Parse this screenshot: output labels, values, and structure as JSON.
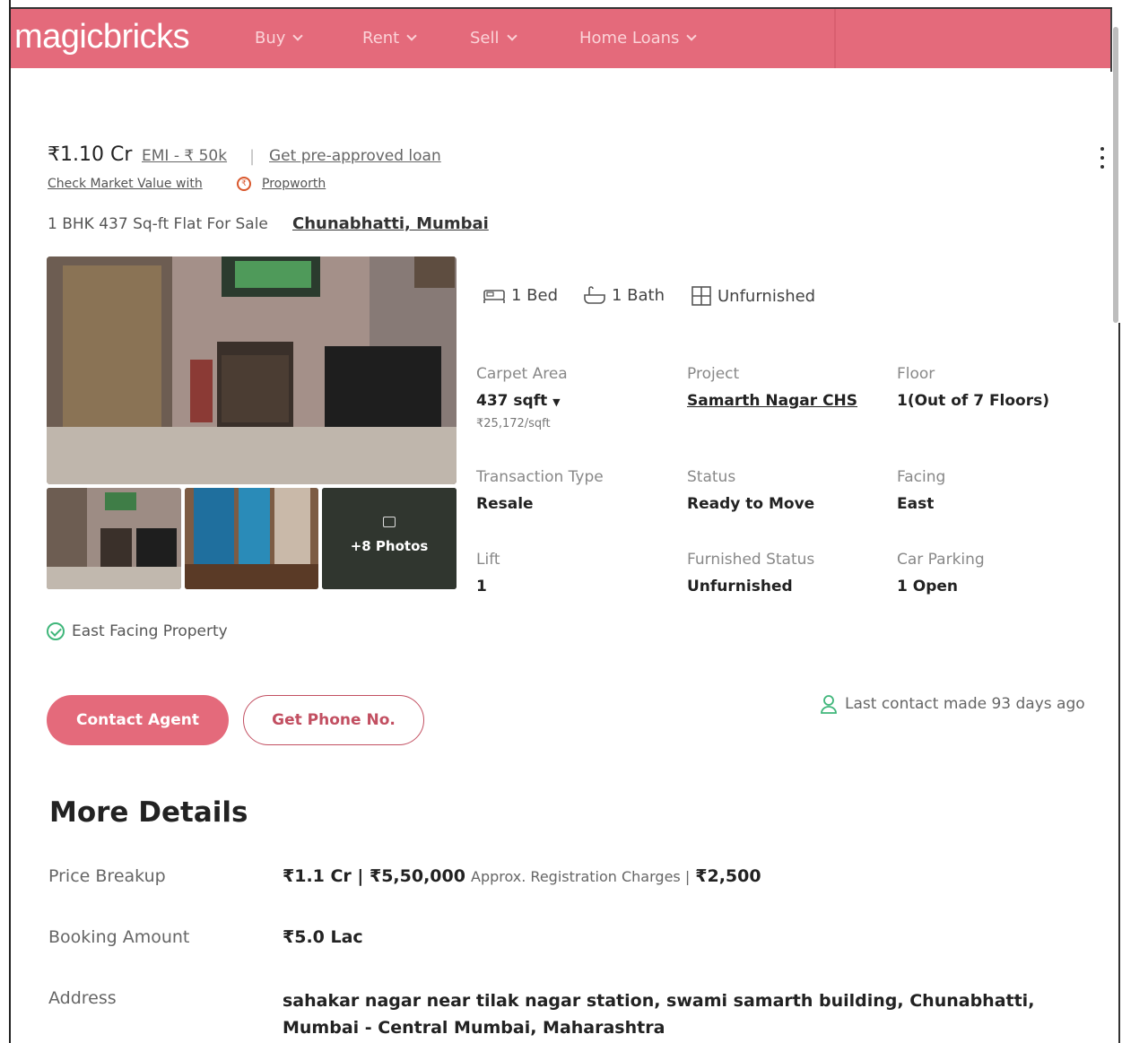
{
  "header": {
    "logo": "magicbricks",
    "nav": [
      {
        "label": "Buy"
      },
      {
        "label": "Rent"
      },
      {
        "label": "Sell"
      },
      {
        "label": "Home Loans"
      }
    ],
    "color": "#e46a7b"
  },
  "listing": {
    "price": "₹1.10 Cr",
    "emi": "EMI - ₹ 50k",
    "separator": "|",
    "loan_link": "Get pre-approved loan",
    "market_value": "Check Market Value with",
    "propworth": "Propworth",
    "title": "1 BHK 437 Sq-ft Flat For Sale",
    "location": "Chunabhatti, Mumbai",
    "more_photos": "+8 Photos",
    "features": [
      {
        "icon": "bed-icon",
        "label": "1 Bed"
      },
      {
        "icon": "bath-icon",
        "label": "1 Bath"
      },
      {
        "icon": "furnishing-icon",
        "label": "Unfurnished"
      }
    ],
    "specs": {
      "carpet_area": {
        "label": "Carpet Area",
        "value": "437 sqft",
        "sub": "₹25,172/sqft"
      },
      "project": {
        "label": "Project",
        "value": "Samarth Nagar CHS"
      },
      "floor": {
        "label": "Floor",
        "value": "1(Out of 7 Floors)"
      },
      "transaction": {
        "label": "Transaction Type",
        "value": "Resale"
      },
      "status": {
        "label": "Status",
        "value": "Ready to Move"
      },
      "facing": {
        "label": "Facing",
        "value": "East"
      },
      "lift": {
        "label": "Lift",
        "value": "1"
      },
      "furnished": {
        "label": "Furnished Status",
        "value": "Unfurnished"
      },
      "parking": {
        "label": "Car Parking",
        "value": "1 Open"
      }
    },
    "highlight": "East Facing Property",
    "contact_button": "Contact Agent",
    "phone_button": "Get Phone No.",
    "last_contact": "Last contact made 93 days ago"
  },
  "more_details": {
    "title": "More Details",
    "price_breakup": {
      "label": "Price Breakup",
      "value": "₹1.1 Cr | ₹5,50,000",
      "note": "Approx. Registration Charges |",
      "extra": "₹2,500"
    },
    "booking": {
      "label": "Booking Amount",
      "value": "₹5.0 Lac"
    },
    "address": {
      "label": "Address",
      "value": "sahakar nagar near tilak nagar station, swami samarth building, Chunabhatti, Mumbai - Central Mumbai, Maharashtra"
    }
  }
}
